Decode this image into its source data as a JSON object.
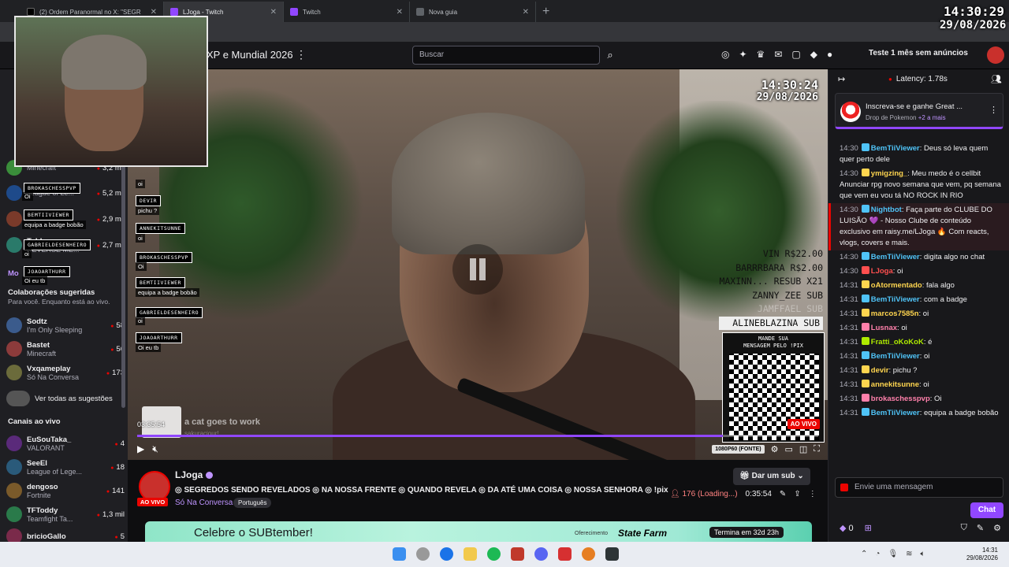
{
  "browser": {
    "tabs": [
      {
        "label": "(2) Ordem Paranormal no X: \"SEGR",
        "color": "#000000"
      },
      {
        "label": "LJoga - Twitch",
        "color": "#9147ff"
      },
      {
        "label": "Twitch",
        "color": "#9147ff"
      },
      {
        "label": "Nova guia",
        "color": "#5f6368"
      }
    ],
    "new_tab": "+"
  },
  "overlay_clock": {
    "time": "14:30:29",
    "date": "29/08/2026"
  },
  "twitch_header": {
    "title_fragment": "XP e Mundial 2026",
    "search_placeholder": "Buscar",
    "ad_free": "Teste 1 mês sem anúncios"
  },
  "sidebar": {
    "top_items": [
      {
        "name": "",
        "game": "Minecraft",
        "viewers": "3,2 mil",
        "color": "#3a8d3a"
      },
      {
        "name": "",
        "game": "League of Le...",
        "viewers": "5,2 mil",
        "color": "#1e4a8a"
      },
      {
        "name": "",
        "game": "",
        "viewers": "2,9 mil",
        "color": "#7a3a2a"
      },
      {
        "name": "Tubbo",
        "game": "REVERSE ME...",
        "viewers": "2,7 mil",
        "color": "#2a7a6a"
      }
    ],
    "more": "Mo",
    "collab_title": "Colaborações sugeridas",
    "collab_sub": "Para você. Enquanto está ao vivo.",
    "collab_items": [
      {
        "name": "Sodtz",
        "game": "I'm Only Sleeping",
        "viewers": "58",
        "color": "#3b5b8c"
      },
      {
        "name": "Bastet",
        "game": "Minecraft",
        "viewers": "56",
        "color": "#8c3b3b"
      },
      {
        "name": "Vxqameplay",
        "game": "Só Na Conversa",
        "viewers": "173",
        "color": "#6b6b3b"
      }
    ],
    "see_all": "Ver todas as sugestões",
    "live_title": "Canais ao vivo",
    "live_items": [
      {
        "name": "EuSouTaka_",
        "game": "VALORANT",
        "viewers": "4",
        "color": "#5a2a7a"
      },
      {
        "name": "SeeEl",
        "game": "League of Lege...",
        "viewers": "18",
        "color": "#2a5a7a"
      },
      {
        "name": "dengoso",
        "game": "Fortnite",
        "viewers": "141",
        "color": "#7a5a2a"
      },
      {
        "name": "TFToddy",
        "game": "Teamfight Ta...",
        "viewers": "1,3 mil",
        "color": "#2a7a4a"
      },
      {
        "name": "bricioGallo",
        "game": "",
        "viewers": "5",
        "color": "#7a2a4a"
      }
    ]
  },
  "stream_chat_overlay": [
    {
      "user": "BROKASCHESSPVP",
      "msg": "Oi"
    },
    {
      "user": "BEMTIIVIEWER",
      "msg": "equipa a badge bobão"
    },
    {
      "user": "GABRIELDESENHEIRO",
      "msg": "oi"
    },
    {
      "user": "JOAOARTHURR",
      "msg": "Oi eu tb"
    }
  ],
  "stream_chat_overlay2": [
    {
      "user": "DEVIR",
      "msg": "pichu ?"
    },
    {
      "user": "ANNEKITSUNNE",
      "msg": "oi"
    },
    {
      "user": "BROKASCHESSPVP",
      "msg": "Oi"
    },
    {
      "user": "BEMTIIVIEWER",
      "msg": "equipa a badge bobão"
    },
    {
      "user": "GABRIELDESENHEIRO",
      "msg": "oi"
    },
    {
      "user": "JOAOARTHURR",
      "msg": "Oi eu tb"
    }
  ],
  "stream_chat_first_msg": "oi",
  "stream_clock": {
    "time": "14:30:24",
    "date": "29/08/2026"
  },
  "donors": [
    "VIN R$22.00",
    "BARRRBARA R$2.00",
    "MAXINN... RESUB X21",
    "ZANNY_ZEE SUB",
    "JAMFFAEL SUB",
    "ALINEBLAZINA SUB"
  ],
  "qr": {
    "title1": "MANDE SUA",
    "title2": "MENSAGEM PELO !PIX"
  },
  "player": {
    "live_tag": "AO VIVO",
    "time": "03:35:54",
    "song": "a cat goes to work",
    "song_sub": "sakuraciour!",
    "quality": "1080P60 (FONTE)",
    "progress": 0.86
  },
  "channel": {
    "name": "LJoga",
    "live": "AO VIVO",
    "title": "◎ SEGREDOS SENDO REVELADOS ◎ NA NOSSA FRENTE ◎ QUANDO REVELA ◎ DA ATÉ UMA COISA ◎ NOSSA SENHORA ◎ !pix",
    "category": "Só Na Conversa",
    "language": "Português",
    "sub_button": "Dar um sub",
    "viewers": "176 (Loading...)",
    "uptime": "0:35:54"
  },
  "banner": {
    "text": "Celebre o SUBtember!",
    "offered": "Oferecimento",
    "brand": "State Farm",
    "ends": "Termina em 32d 23h"
  },
  "chat": {
    "latency": "Latency: 1.78s",
    "drop_title": "Inscreva-se e ganhe Great ...",
    "drop_sub": "Drop de Pokemon",
    "drop_more": "+2 a mais",
    "lines": [
      {
        "ts": "14:30",
        "user": "BemTiiViewer",
        "color": "#4fc3f7",
        "text": ": Deus só leva quem quer perto dele",
        "hl": false
      },
      {
        "ts": "14:30",
        "user": "ymigzing_",
        "color": "#ffd54f",
        "text": ": Meu medo é o cellbit Anunciar rpg novo semana que vem, pq semana que vem eu vou tá NO ROCK IN RIO",
        "hl": false
      },
      {
        "ts": "14:30",
        "user": "Nightbot",
        "color": "#4fc3f7",
        "text": ": Faça parte do CLUBE DO LUISÃO 💜 - Nosso Clube de conteúdo exclusivo em raisy.me/LJoga 🔥 Com reacts, vlogs, covers e mais.",
        "hl": true
      },
      {
        "ts": "14:30",
        "user": "BemTiiViewer",
        "color": "#4fc3f7",
        "text": ": digita algo no chat",
        "hl": false
      },
      {
        "ts": "14:30",
        "user": "LJoga",
        "color": "#ff4f4f",
        "text": ": oi",
        "hl": false
      },
      {
        "ts": "14:31",
        "user": "oAtormentado",
        "color": "#ffd54f",
        "text": ": fala algo",
        "hl": false
      },
      {
        "ts": "14:31",
        "user": "BemTiiViewer",
        "color": "#4fc3f7",
        "text": ": com a badge",
        "hl": false
      },
      {
        "ts": "14:31",
        "user": "marcos7585n",
        "color": "#ffd54f",
        "text": ": oi",
        "hl": false
      },
      {
        "ts": "14:31",
        "user": "Lusnax",
        "color": "#ff80ab",
        "text": ": oi",
        "hl": false
      },
      {
        "ts": "14:31",
        "user": "Fratti_oKoKoK",
        "color": "#aeea00",
        "text": ": é",
        "hl": false
      },
      {
        "ts": "14:31",
        "user": "BemTiiViewer",
        "color": "#4fc3f7",
        "text": ": oi",
        "hl": false
      },
      {
        "ts": "14:31",
        "user": "devir",
        "color": "#ffd54f",
        "text": ": pichu ?",
        "hl": false
      },
      {
        "ts": "14:31",
        "user": "annekitsunne",
        "color": "#ffd54f",
        "text": ": oi",
        "hl": false
      },
      {
        "ts": "14:31",
        "user": "brokaschesspvp",
        "color": "#ff80ab",
        "text": ": Oi",
        "hl": false
      },
      {
        "ts": "14:31",
        "user": "BemTiiViewer",
        "color": "#4fc3f7",
        "text": ": equipa a badge bobão",
        "hl": false
      }
    ],
    "input_placeholder": "Envie uma mensagem",
    "send_button": "Chat",
    "points": "0"
  },
  "taskbar": {
    "time": "14:31",
    "date": "29/08/2026"
  }
}
